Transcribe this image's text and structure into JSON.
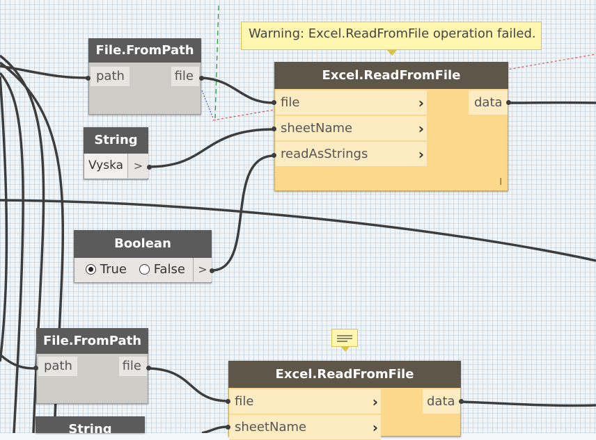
{
  "tooltip": {
    "warning": "Warning: Excel.ReadFromFile operation failed."
  },
  "nodes": {
    "filepath1": {
      "title": "File.FromPath",
      "in_port": "path",
      "out_port": "file"
    },
    "string1": {
      "title": "String",
      "value": "Vyska",
      "out_port": ">"
    },
    "boolean1": {
      "title": "Boolean",
      "opt_true": "True",
      "opt_false": "False",
      "out_port": ">"
    },
    "excel1": {
      "title": "Excel.ReadFromFile",
      "in_ports": [
        "file",
        "sheetName",
        "readAsStrings"
      ],
      "out_port": "data",
      "lacing": "l"
    },
    "filepath2": {
      "title": "File.FromPath",
      "in_port": "path",
      "out_port": "file"
    },
    "excel2": {
      "title": "Excel.ReadFromFile",
      "in_ports": [
        "file",
        "sheetName"
      ],
      "out_port": "data"
    },
    "string2": {
      "title": "String"
    }
  },
  "colors": {
    "node_header": "#5b5b5b",
    "excel_header": "#5e5648",
    "excel_body": "#fcd88c",
    "warning_bg": "#fff6b0",
    "wire": "#3d3d3d"
  }
}
